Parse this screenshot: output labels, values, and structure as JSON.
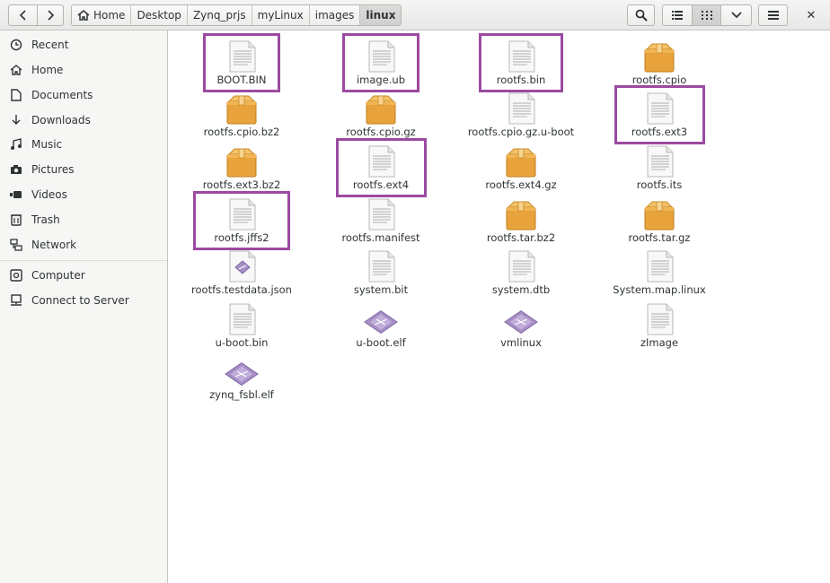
{
  "toolbar": {
    "back_icon": "go-back-icon",
    "forward_icon": "go-forward-icon",
    "search_icon": "search-icon",
    "list_view_icon": "list-view-icon",
    "grid_view_icon": "grid-view-icon",
    "view_options_icon": "chevron-down-icon",
    "menu_icon": "hamburger-menu-icon",
    "close_label": "✕"
  },
  "breadcrumb": [
    "Home",
    "Desktop",
    "Zynq_prjs",
    "myLinux",
    "images",
    "linux"
  ],
  "sidebar": {
    "items": [
      {
        "label": "Recent",
        "icon": "clock-icon"
      },
      {
        "label": "Home",
        "icon": "home-icon"
      },
      {
        "label": "Documents",
        "icon": "document-icon"
      },
      {
        "label": "Downloads",
        "icon": "download-icon"
      },
      {
        "label": "Music",
        "icon": "music-icon"
      },
      {
        "label": "Pictures",
        "icon": "camera-icon"
      },
      {
        "label": "Videos",
        "icon": "video-icon"
      },
      {
        "label": "Trash",
        "icon": "trash-icon"
      },
      {
        "label": "Network",
        "icon": "network-icon"
      },
      {
        "label": "Computer",
        "icon": "computer-icon"
      },
      {
        "label": "Connect to Server",
        "icon": "server-icon"
      }
    ]
  },
  "files": [
    {
      "name": "BOOT.BIN",
      "type": "text",
      "highlighted": true
    },
    {
      "name": "image.ub",
      "type": "text",
      "highlighted": true
    },
    {
      "name": "rootfs.bin",
      "type": "text",
      "highlighted": true
    },
    {
      "name": "rootfs.cpio",
      "type": "archive",
      "highlighted": false
    },
    {
      "name": "rootfs.cpio.bz2",
      "type": "archive",
      "highlighted": false
    },
    {
      "name": "rootfs.cpio.gz",
      "type": "archive",
      "highlighted": false
    },
    {
      "name": "rootfs.cpio.gz.u-boot",
      "type": "text",
      "highlighted": false
    },
    {
      "name": "rootfs.ext3",
      "type": "text",
      "highlighted": true
    },
    {
      "name": "rootfs.ext3.bz2",
      "type": "archive",
      "highlighted": false
    },
    {
      "name": "rootfs.ext4",
      "type": "text",
      "highlighted": true
    },
    {
      "name": "rootfs.ext4.gz",
      "type": "archive",
      "highlighted": false
    },
    {
      "name": "rootfs.its",
      "type": "text",
      "highlighted": false
    },
    {
      "name": "rootfs.jffs2",
      "type": "text",
      "highlighted": true
    },
    {
      "name": "rootfs.manifest",
      "type": "text",
      "highlighted": false
    },
    {
      "name": "rootfs.tar.bz2",
      "type": "archive",
      "highlighted": false
    },
    {
      "name": "rootfs.tar.gz",
      "type": "archive",
      "highlighted": false
    },
    {
      "name": "rootfs.testdata.json",
      "type": "json",
      "highlighted": false
    },
    {
      "name": "system.bit",
      "type": "text",
      "highlighted": false
    },
    {
      "name": "system.dtb",
      "type": "text",
      "highlighted": false
    },
    {
      "name": "System.map.linux",
      "type": "text",
      "highlighted": false
    },
    {
      "name": "u-boot.bin",
      "type": "text",
      "highlighted": false
    },
    {
      "name": "u-boot.elf",
      "type": "executable",
      "highlighted": false
    },
    {
      "name": "vmlinux",
      "type": "executable",
      "highlighted": false
    },
    {
      "name": "zImage",
      "type": "text",
      "highlighted": false
    },
    {
      "name": "zynq_fsbl.elf",
      "type": "executable",
      "highlighted": false
    }
  ],
  "colors": {
    "highlight": "#9b4aa0",
    "archive": "#e8a33c",
    "executable": "#a78fc6"
  }
}
